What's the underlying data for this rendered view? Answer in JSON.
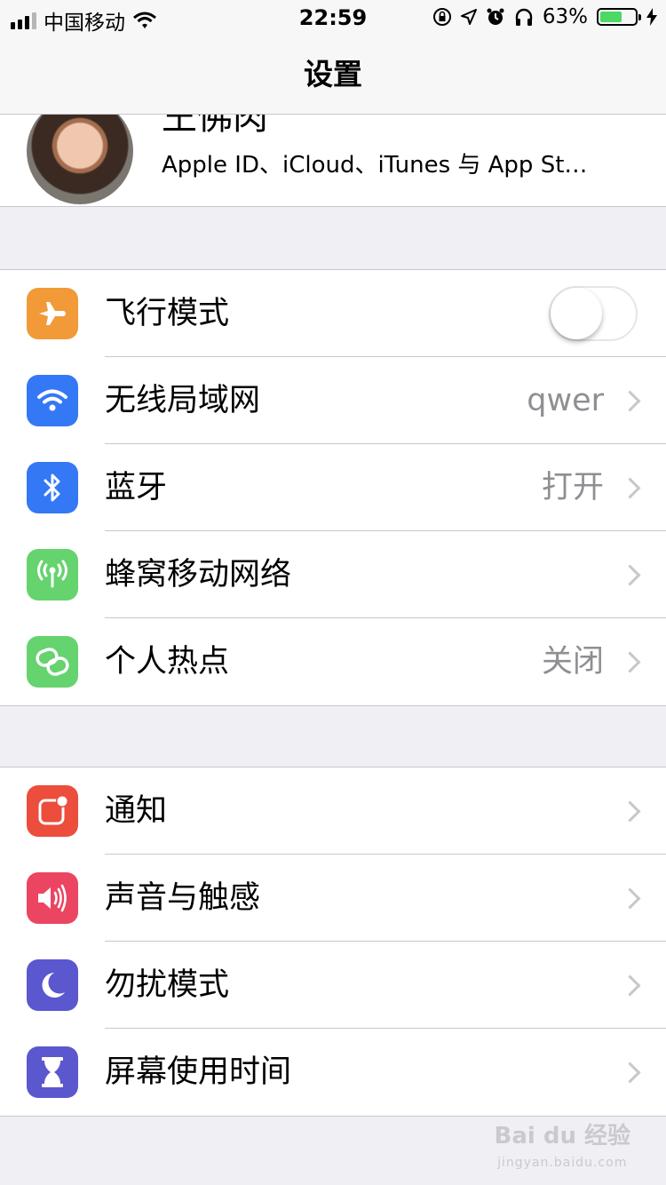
{
  "status_bar": {
    "carrier": "中国移动",
    "time": "22:59",
    "battery_percent": "63%",
    "battery_level": 0.63,
    "icons": [
      "signal-icon",
      "wifi-icon",
      "orientation-lock-icon",
      "location-icon",
      "alarm-icon",
      "headphones-icon",
      "battery-icon",
      "charging-icon"
    ]
  },
  "nav": {
    "title": "设置"
  },
  "profile": {
    "name": "王佛肉",
    "subtitle": "Apple ID、iCloud、iTunes 与 App St…"
  },
  "group1": [
    {
      "label": "飞行模式",
      "icon": "airplane-icon",
      "color": "#f19a37",
      "toggle": false
    },
    {
      "label": "无线局域网",
      "icon": "wifi-icon",
      "color": "#3478f6",
      "value": "qwer"
    },
    {
      "label": "蓝牙",
      "icon": "bluetooth-icon",
      "color": "#3478f6",
      "value": "打开"
    },
    {
      "label": "蜂窝移动网络",
      "icon": "antenna-icon",
      "color": "#65d36e",
      "value": ""
    },
    {
      "label": "个人热点",
      "icon": "hotspot-icon",
      "color": "#65d36e",
      "value": "关闭"
    }
  ],
  "group2": [
    {
      "label": "通知",
      "icon": "notifications-icon",
      "color": "#ec4d3d"
    },
    {
      "label": "声音与触感",
      "icon": "speaker-icon",
      "color": "#eb4562"
    },
    {
      "label": "勿扰模式",
      "icon": "moon-icon",
      "color": "#5b57cf"
    },
    {
      "label": "屏幕使用时间",
      "icon": "hourglass-icon",
      "color": "#5b57cf"
    }
  ],
  "watermark": {
    "text": "Bai du 经验",
    "sub": "jingyan.baidu.com"
  }
}
